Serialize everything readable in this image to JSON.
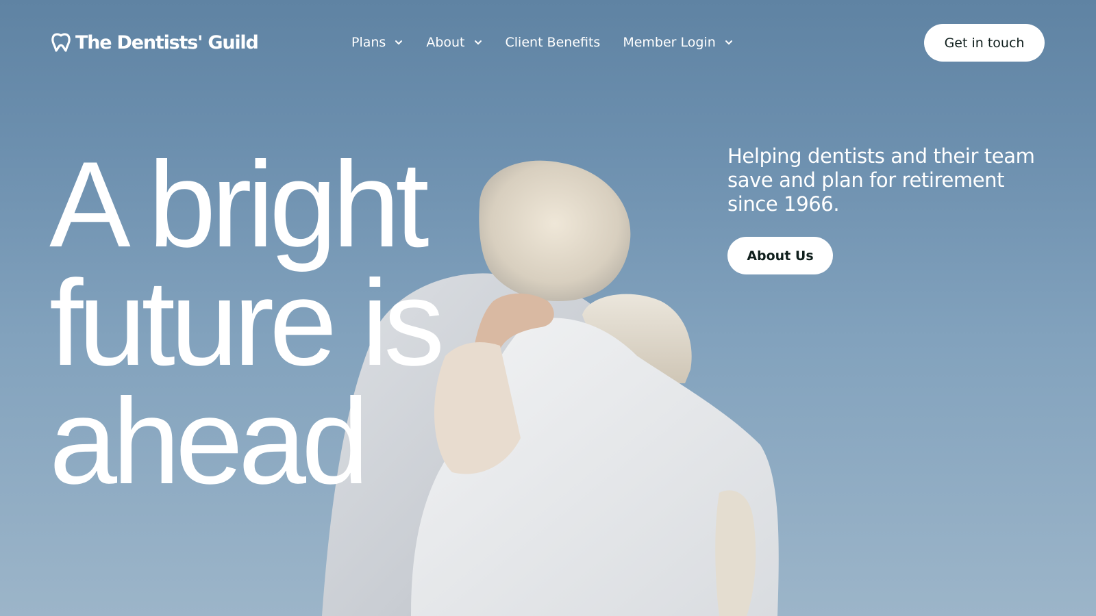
{
  "header": {
    "logo_text": "The Dentists' Guild",
    "nav": [
      {
        "label": "Plans",
        "has_dropdown": true
      },
      {
        "label": "About",
        "has_dropdown": true
      },
      {
        "label": "Client Benefits",
        "has_dropdown": false
      },
      {
        "label": "Member Login",
        "has_dropdown": true
      }
    ],
    "cta_label": "Get in touch"
  },
  "hero": {
    "headline_lines": [
      "A bright",
      "future is",
      "ahead"
    ],
    "tagline": "Helping dentists and their team save and plan for retirement since 1966.",
    "about_button_label": "About Us",
    "background_image": "elderly couple embracing against a blue sky"
  },
  "colors": {
    "sky_top": "#5f83a3",
    "sky_bottom": "#9cb5c9",
    "text_on_image": "#ffffff",
    "button_bg": "#ffffff",
    "button_text": "#0f1e1c"
  }
}
